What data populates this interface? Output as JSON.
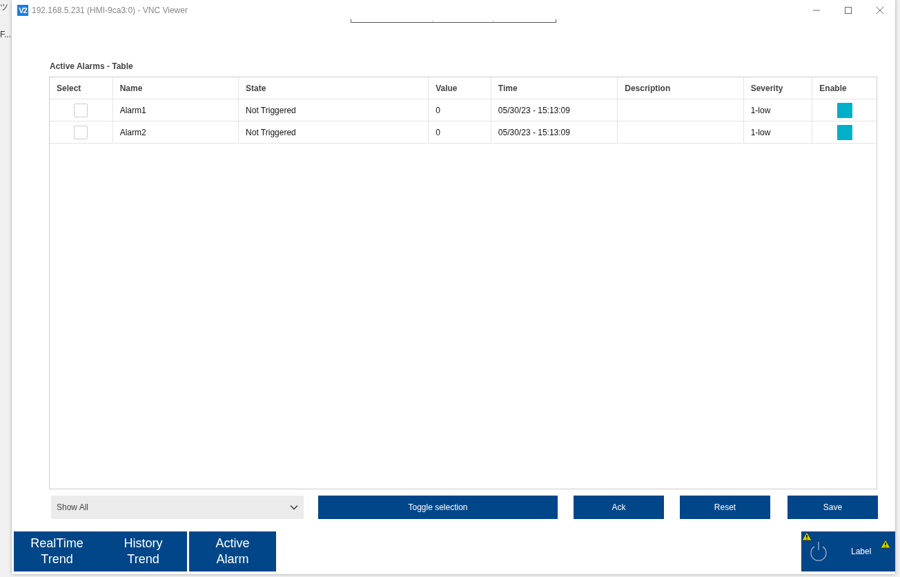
{
  "background": {
    "texts": [
      "ツ",
      "F..."
    ]
  },
  "window": {
    "title": "192.168.5.231 (HMI-9ca3:0) - VNC Viewer",
    "app_icon": "V2"
  },
  "table": {
    "title": "Active Alarms - Table",
    "columns": [
      "Select",
      "Name",
      "State",
      "Value",
      "Time",
      "Description",
      "Severity",
      "Enable"
    ],
    "rows": [
      {
        "checked": false,
        "name": "Alarm1",
        "state": "Not Triggered",
        "value": "0",
        "time": "05/30/23 - 15:13:09",
        "description": "",
        "severity": "1-low",
        "enabled": true
      },
      {
        "checked": false,
        "name": "Alarm2",
        "state": "Not Triggered",
        "value": "0",
        "time": "05/30/23 - 15:13:09",
        "description": "",
        "severity": "1-low",
        "enabled": true
      }
    ]
  },
  "filter": {
    "value": "Show All"
  },
  "buttons": [
    "Toggle selection",
    "Ack",
    "Reset",
    "Save"
  ],
  "nav": [
    {
      "label": "RealTime\nTrend"
    },
    {
      "label": "History\nTrend"
    },
    {
      "label": "Active\nAlarm"
    }
  ],
  "status_panel": {
    "label": "Label"
  }
}
